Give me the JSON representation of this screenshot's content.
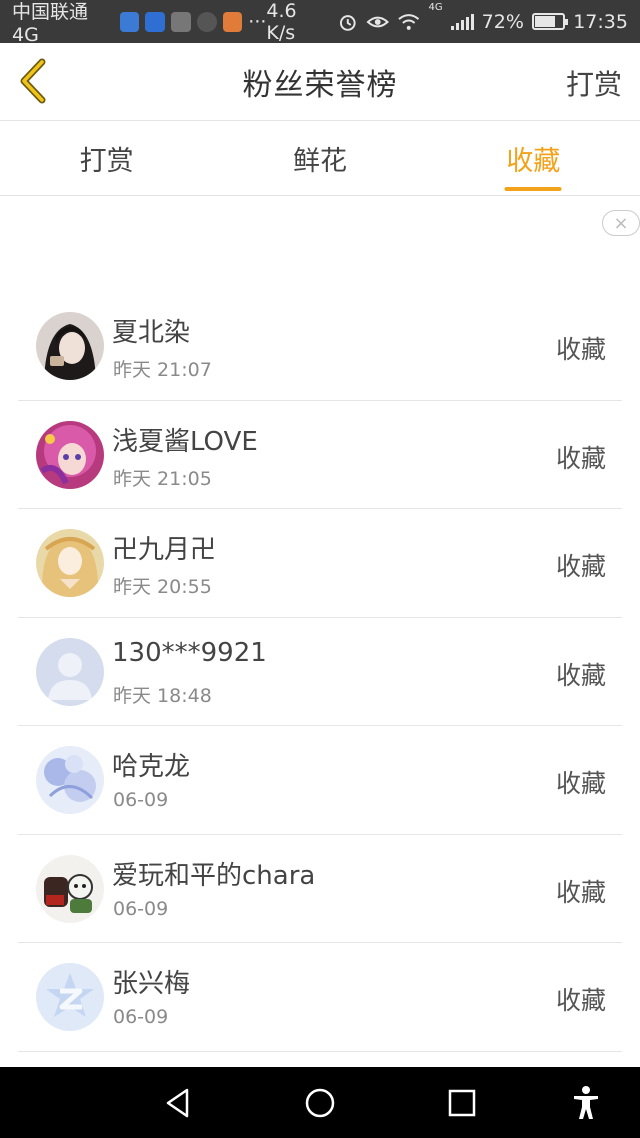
{
  "status_bar": {
    "carrier": "中国联通4G",
    "more": "···",
    "net_speed": "4.6 K/s",
    "network_type": "4G",
    "battery_percent": "72%",
    "battery_level": 0.72,
    "time": "17:35",
    "app_icons": [
      "baidu-icon",
      "paw-icon",
      "photo-icon",
      "wechat-icon",
      "video-icon"
    ]
  },
  "header": {
    "title": "粉丝荣誉榜",
    "action": "打赏"
  },
  "tabs": [
    {
      "label": "打赏",
      "active": false
    },
    {
      "label": "鲜花",
      "active": false
    },
    {
      "label": "收藏",
      "active": true
    }
  ],
  "close_label": "×",
  "fans": [
    {
      "name": "夏北染",
      "time": "昨天 21:07",
      "action": "收藏",
      "avatar": "photo"
    },
    {
      "name": "浅夏酱LOVE",
      "time": "昨天 21:05",
      "action": "收藏",
      "avatar": "anime-pink"
    },
    {
      "name": "卍九月卍",
      "time": "昨天 20:55",
      "action": "收藏",
      "avatar": "anime-gold"
    },
    {
      "name": "130***9921",
      "time": "昨天 18:48",
      "action": "收藏",
      "avatar": "default"
    },
    {
      "name": "哈克龙",
      "time": "06-09",
      "action": "收藏",
      "avatar": "blue-floral"
    },
    {
      "name": "爱玩和平的chara",
      "time": "06-09",
      "action": "收藏",
      "avatar": "cartoon"
    },
    {
      "name": "张兴梅",
      "time": "06-09",
      "action": "收藏",
      "avatar": "qzone"
    }
  ],
  "colors": {
    "accent": "#f3a21b",
    "status_bar_bg": "#3a3a3a",
    "divider": "#e6e6e6"
  }
}
